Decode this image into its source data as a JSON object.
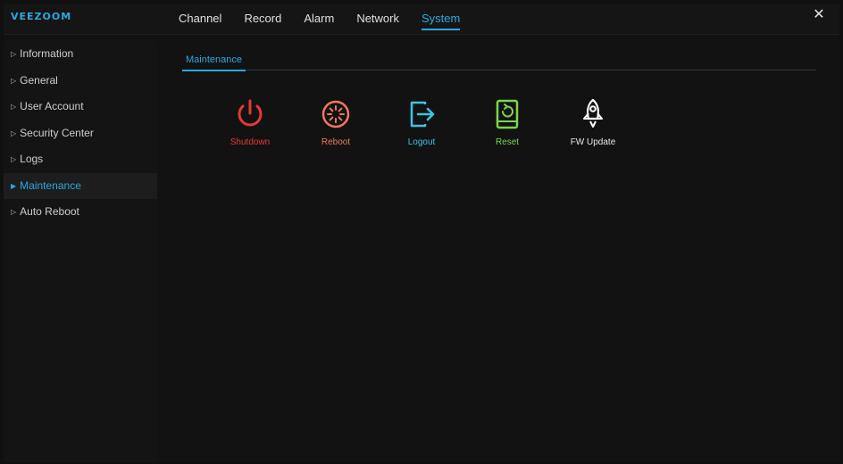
{
  "app": {
    "logo": "VEEZOOM",
    "close_icon": "close-icon"
  },
  "tabs": [
    {
      "label": "Channel",
      "active": false
    },
    {
      "label": "Record",
      "active": false
    },
    {
      "label": "Alarm",
      "active": false
    },
    {
      "label": "Network",
      "active": false
    },
    {
      "label": "System",
      "active": true
    }
  ],
  "sidebar": {
    "items": [
      {
        "label": "Information",
        "active": false
      },
      {
        "label": "General",
        "active": false
      },
      {
        "label": "User Account",
        "active": false
      },
      {
        "label": "Security Center",
        "active": false
      },
      {
        "label": "Logs",
        "active": false
      },
      {
        "label": "Maintenance",
        "active": true
      },
      {
        "label": "Auto Reboot",
        "active": false
      }
    ]
  },
  "main": {
    "subtab": "Maintenance",
    "actions": [
      {
        "label": "Shutdown",
        "icon": "power-icon",
        "color": "#e53935"
      },
      {
        "label": "Reboot",
        "icon": "reboot-icon",
        "color": "#f07a5a"
      },
      {
        "label": "Logout",
        "icon": "logout-icon",
        "color": "#3cc4e6"
      },
      {
        "label": "Reset",
        "icon": "reset-icon",
        "color": "#7cd64a"
      },
      {
        "label": "FW Update",
        "icon": "rocket-icon",
        "color": "#ffffff"
      }
    ]
  },
  "colors": {
    "accent": "#2aa8e0",
    "background": "#121212"
  }
}
